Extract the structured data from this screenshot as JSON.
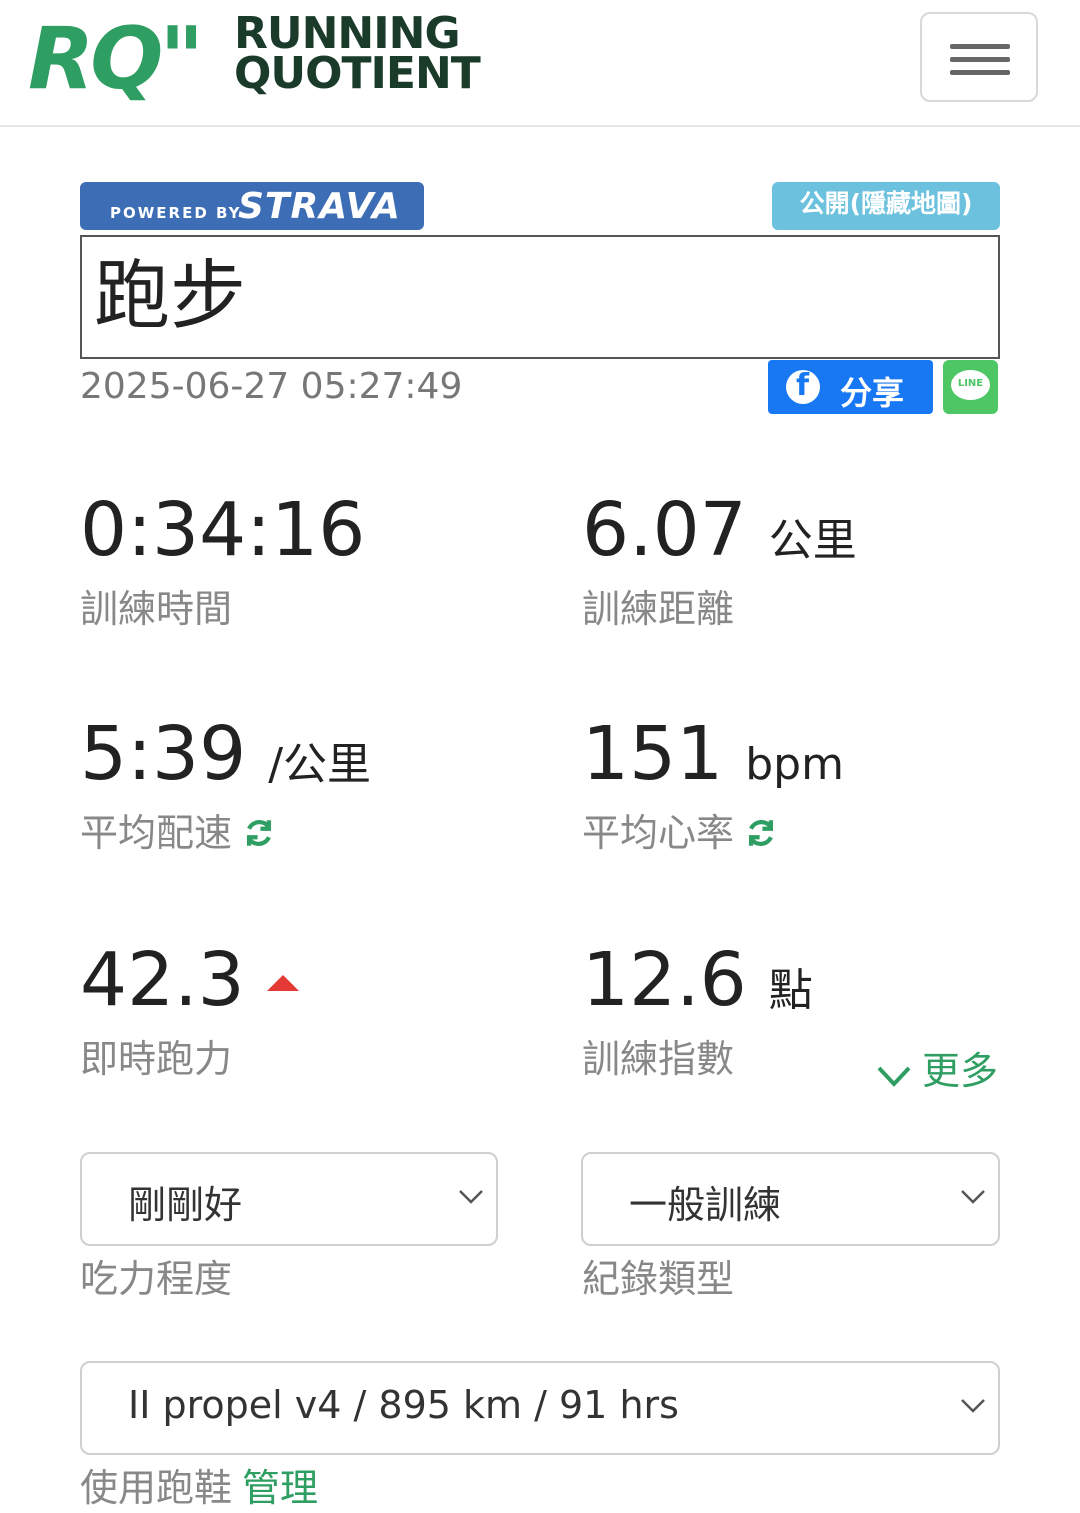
{
  "header": {
    "logo_mark": "RQ\"",
    "logo_line1": "RUNNING",
    "logo_line2": "QUOTIENT"
  },
  "strava": {
    "powered_by": "POWERED BY",
    "brand": "STRAVA"
  },
  "visibility": "公開(隱藏地圖)",
  "activity": {
    "title": "跑步",
    "datetime": "2025-06-27 05:27:49"
  },
  "share": {
    "facebook_label": "分享",
    "line_label": "LINE"
  },
  "stats": {
    "time": {
      "value": "0:34:16",
      "label": "訓練時間"
    },
    "distance": {
      "value": "6.07",
      "unit": "公里",
      "label": "訓練距離"
    },
    "pace": {
      "value": "5:39",
      "unit": "/公里",
      "label": "平均配速"
    },
    "heart_rate": {
      "value": "151",
      "unit": "bpm",
      "label": "平均心率"
    },
    "vdot": {
      "value": "42.3",
      "label": "即時跑力"
    },
    "training_index": {
      "value": "12.6",
      "unit": "點",
      "label": "訓練指數"
    }
  },
  "more_label": "更多",
  "effort": {
    "selected": "剛剛好",
    "label": "吃力程度"
  },
  "record_type": {
    "selected": "一般訓練",
    "label": "紀錄類型"
  },
  "shoes": {
    "selected": "II propel v4 / 895 km / 91 hrs",
    "label": "使用跑鞋",
    "manage_label": "管理"
  },
  "colors": {
    "brand_green": "#2e9e62",
    "strava_blue": "#3d6db5",
    "visibility_blue": "#6cc2de",
    "facebook_blue": "#1877f2",
    "line_green": "#4cc764",
    "up_red": "#e53935"
  }
}
